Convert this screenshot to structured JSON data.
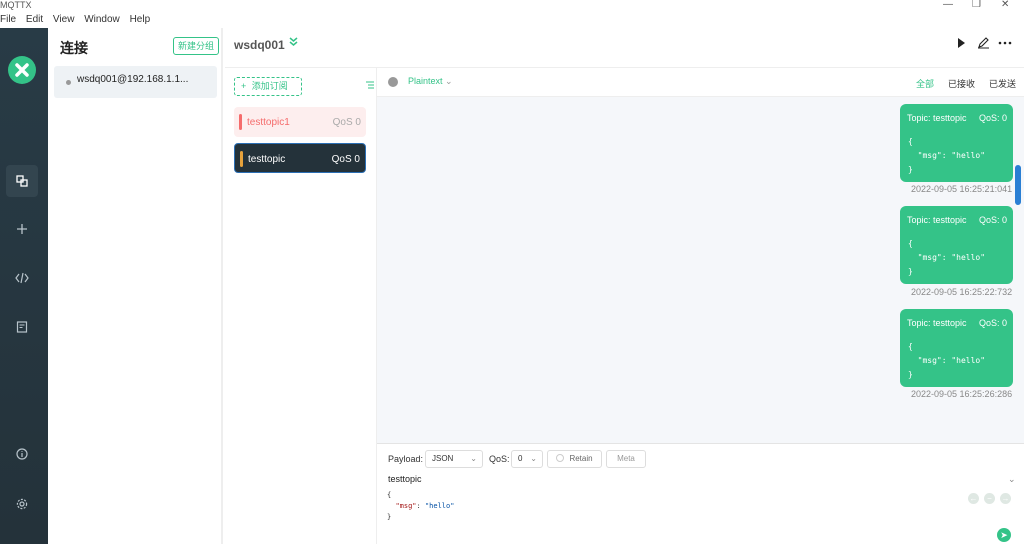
{
  "window": {
    "title": "MQTTX",
    "minimize": "—",
    "maximize": "❐",
    "close": "✕"
  },
  "menu": [
    "File",
    "Edit",
    "View",
    "Window",
    "Help"
  ],
  "connections": {
    "title": "连接",
    "new_group": "新建分组",
    "items": [
      {
        "label": "wsdq001@192.168.1.1..."
      }
    ]
  },
  "header": {
    "name": "wsdq001",
    "chevron": "»",
    "icons": [
      "play-icon",
      "edit-icon",
      "more-icon"
    ]
  },
  "subscriptions": {
    "add_label": "添加订阅",
    "items": [
      {
        "topic": "testtopic1",
        "qos": "QoS 0",
        "color": "#f56c6c",
        "bg": "#fdeeee",
        "text_color": "#f56c6c"
      },
      {
        "topic": "testtopic",
        "qos": "QoS 0",
        "color": "#e6a23c",
        "bg": "#24323a",
        "text_color": "#ffffff"
      }
    ]
  },
  "toolbar": {
    "format": "Plaintext",
    "filters": [
      "全部",
      "已接收",
      "已发送"
    ],
    "active_filter_color": "#34c388"
  },
  "messages": [
    {
      "topic": "Topic: testtopic",
      "qos": "QoS: 0",
      "payload": "{\n  \"msg\": \"hello\"\n}",
      "time": "2022-09-05 16:25:21:041"
    },
    {
      "topic": "Topic: testtopic",
      "qos": "QoS: 0",
      "payload": "{\n  \"msg\": \"hello\"\n}",
      "time": "2022-09-05 16:25:22:732"
    },
    {
      "topic": "Topic: testtopic",
      "qos": "QoS: 0",
      "payload": "{\n  \"msg\": \"hello\"\n}",
      "time": "2022-09-05 16:25:26:286"
    }
  ],
  "editor": {
    "payload_label": "Payload:",
    "payload_type": "JSON",
    "qos_label": "QoS:",
    "qos_value": "0",
    "retain_label": "Retain",
    "meta_label": "Meta",
    "topic": "testtopic",
    "code_open": "{",
    "code_key": "\"msg\"",
    "code_sep": ": ",
    "code_value": "\"hello\"",
    "code_close": "}"
  },
  "colors": {
    "accent": "#34c388",
    "sidebar": "#283b46"
  }
}
